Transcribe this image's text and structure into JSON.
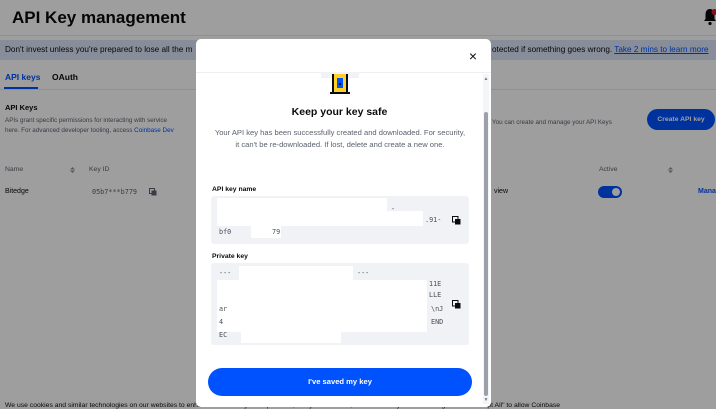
{
  "page": {
    "title": "API Key management",
    "banner_left": "Don't invest unless you're prepared to lose all the m",
    "banner_right_text": "otected if something goes wrong. ",
    "banner_link": "Take 2 mins to learn more",
    "tabs": [
      {
        "label": "API keys",
        "active": true
      },
      {
        "label": "OAuth",
        "active": false
      }
    ],
    "section_title": "API Keys",
    "section_desc_1": "APIs grant specific permissions for interacting with service",
    "section_desc_2": "here. For advanced developer tooling, access ",
    "section_desc_link": "Coinbase Dev",
    "section_desc_right": "You can create and manage your API Keys",
    "create_button": "Create API key",
    "columns": {
      "name": "Name",
      "key_id": "Key ID",
      "active": "Active"
    },
    "row": {
      "name": "Bitedge",
      "key_id": "05b7***b779",
      "permission": "view",
      "active": true,
      "manage": "Mana"
    },
    "cookie_text": "We use cookies and similar technologies on our websites to enhance and tailor your experience, analyze our traffic, and for security and marketing. Select \"Accept All\" to allow Coinbase"
  },
  "modal": {
    "title": "Keep your key safe",
    "description": "Your API key has been successfully created and downloaded. For security, it can't be re-downloaded. If lost, delete and create a new one.",
    "api_key_label": "API key name",
    "api_key_fragments": {
      "a": "-",
      "b": ".91-",
      "c": "bf0",
      "d": "79"
    },
    "private_key_label": "Private key",
    "private_key_fragments": {
      "line1a": "---",
      "line1b": "---",
      "line2": "11E",
      "line3": "LLE",
      "line4a": "ar",
      "line4b": "\\nJ",
      "line5a": "4",
      "line5b": "END",
      "line6": "EC"
    },
    "primary_button": "I've saved my key",
    "close_glyph": "×"
  },
  "colors": {
    "brand_blue": "#0052ff",
    "banner_bg": "#dbe5f7",
    "overlay": "rgba(0,0,0,0.38)"
  },
  "icons": [
    "bell-icon",
    "copy-icon",
    "close-icon",
    "lock-icon",
    "sort-icon"
  ]
}
